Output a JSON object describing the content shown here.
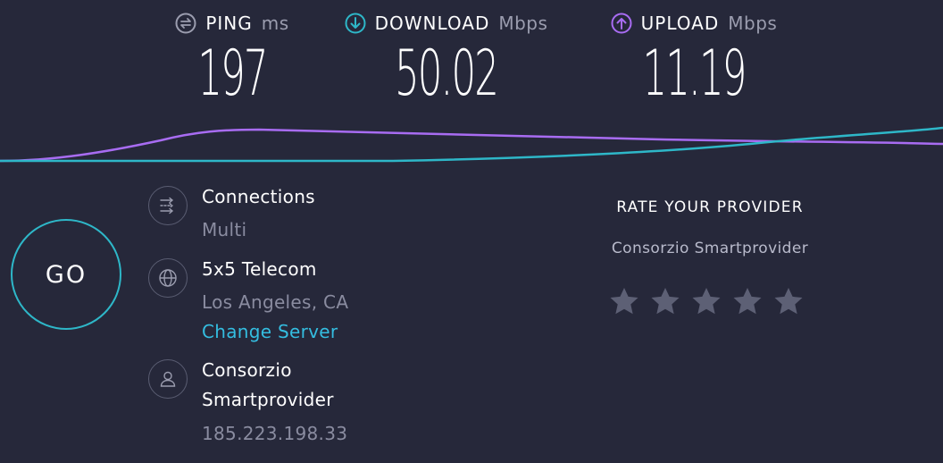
{
  "metrics": {
    "ping": {
      "label": "PING",
      "unit": "ms",
      "value": "197",
      "icon": "ping-icon",
      "color": "#9b9daf"
    },
    "download": {
      "label": "DOWNLOAD",
      "unit": "Mbps",
      "value": "50.02",
      "icon": "download-arrow-icon",
      "color": "#2eb7c8"
    },
    "upload": {
      "label": "UPLOAD",
      "unit": "Mbps",
      "value": "11.19",
      "icon": "upload-arrow-icon",
      "color": "#a86cf2"
    }
  },
  "go_button": {
    "label": "GO"
  },
  "connections": {
    "label": "Connections",
    "value": "Multi",
    "icon": "connections-icon"
  },
  "server": {
    "name": "5x5 Telecom",
    "location": "Los Angeles, CA",
    "change_label": "Change Server",
    "icon": "globe-icon"
  },
  "provider": {
    "name_line1": "Consorzio",
    "name_line2": "Smartprovider",
    "ip": "185.223.198.33",
    "icon": "user-icon"
  },
  "rating": {
    "title": "RATE YOUR PROVIDER",
    "provider_name": "Consorzio Smartprovider",
    "star_count": 5,
    "rating": 0,
    "star_color": "#5d6075"
  },
  "colors": {
    "background": "#26283a",
    "download_line": "#2eb7c8",
    "upload_line": "#a86cf2",
    "link": "#34bde0"
  }
}
